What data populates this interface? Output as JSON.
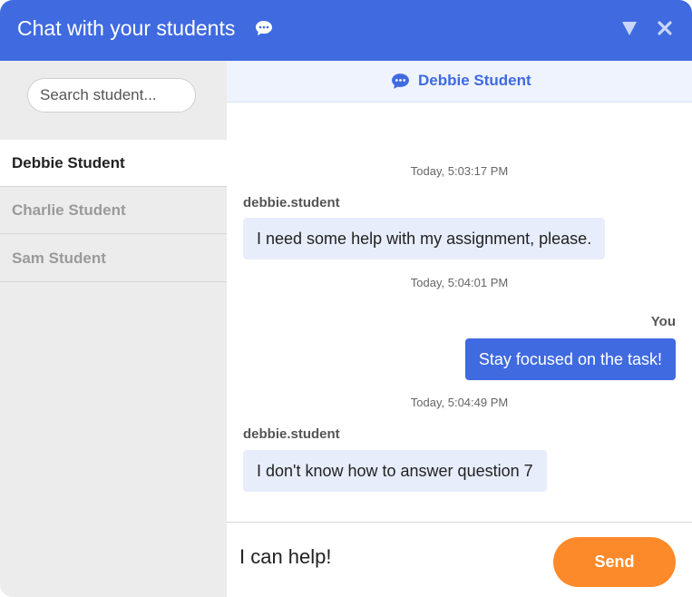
{
  "window": {
    "title": "Chat with your students",
    "title_icon": "chat-bubble-icon",
    "minimize_icon": "triangle-down-icon",
    "close_icon": "close-icon",
    "colors": {
      "header": "#3f6ae0",
      "send": "#fd8a2a"
    }
  },
  "sidebar": {
    "search_placeholder": "Search student...",
    "students": [
      {
        "name": "Debbie Student",
        "active": true
      },
      {
        "name": "Charlie Student",
        "active": false
      },
      {
        "name": "Sam Student",
        "active": false
      }
    ]
  },
  "chat": {
    "header_name": "Debbie Student",
    "header_icon": "chat-bubble-icon",
    "messages": [
      {
        "timestamp": "Today, 5:03:17 PM",
        "sender": "debbie.student",
        "text": "I need some help with my assignment, please.",
        "direction": "in"
      },
      {
        "timestamp": "Today, 5:04:01 PM",
        "sender": "You",
        "text": "Stay focused on the task!",
        "direction": "out"
      },
      {
        "timestamp": "Today, 5:04:49 PM",
        "sender": "debbie.student",
        "text": "I don't know how to answer question 7",
        "direction": "in"
      }
    ]
  },
  "composer": {
    "value": "I can help!",
    "send_label": "Send"
  }
}
